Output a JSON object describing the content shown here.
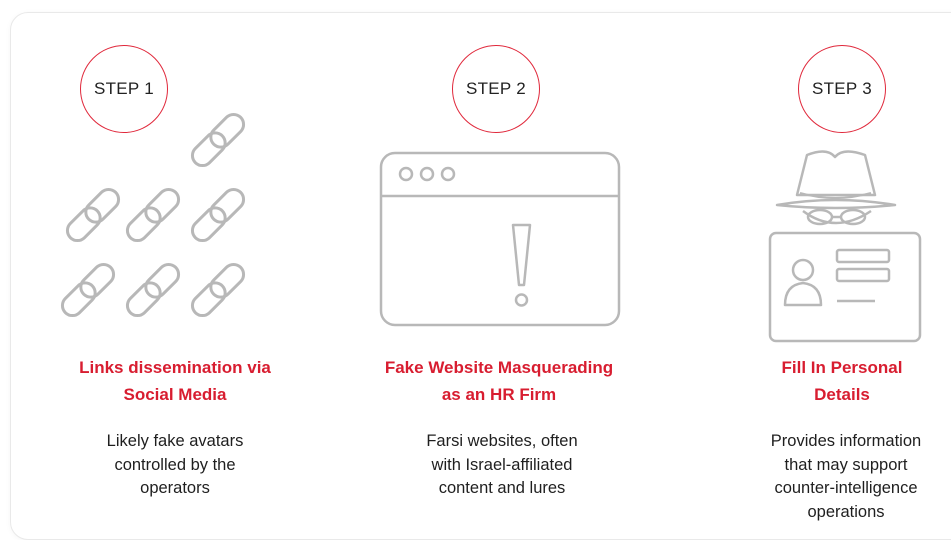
{
  "steps": [
    {
      "badge": "STEP 1",
      "title_lines": [
        "Links dissemination via",
        "Social Media"
      ],
      "desc_lines": [
        "Likely fake avatars",
        "controlled by the",
        "operators"
      ],
      "icon": "chain-link-icon"
    },
    {
      "badge": "STEP 2",
      "title_lines": [
        "Fake Website Masquerading",
        "as an HR Firm"
      ],
      "desc_lines": [
        "Farsi websites, often",
        "with Israel-affiliated",
        "content and lures"
      ],
      "icon": "browser-warning-icon"
    },
    {
      "badge": "STEP 3",
      "title_lines": [
        "Fill In Personal",
        "Details"
      ],
      "desc_lines": [
        "Provides information",
        "that may support",
        "counter-intelligence",
        "operations"
      ],
      "icon": "spy-id-card-icon"
    }
  ],
  "colors": {
    "accent": "#e0283b",
    "title": "#d81d30",
    "icon_stroke": "#b8b8b8",
    "text": "#1f1f1f"
  }
}
